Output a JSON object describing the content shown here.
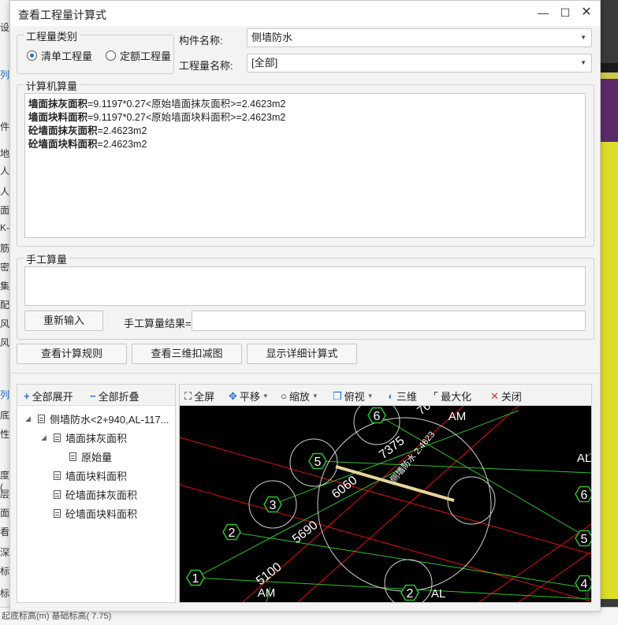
{
  "background": {
    "left_fragments": [
      "设",
      "列",
      "件",
      "地",
      "人",
      "人",
      "面-",
      "K-",
      "筋",
      "密",
      "集",
      "配",
      "风",
      "风",
      "列",
      "底",
      "性",
      "度(",
      "层",
      "面",
      "看",
      "深",
      "标",
      "标"
    ],
    "bottom_text": "起底标高(m)  基础标高( 7.75)"
  },
  "dialog": {
    "title": "查看工程量计算式",
    "category_group": {
      "legend": "工程量类别",
      "options": [
        {
          "label": "清单工程量",
          "selected": true
        },
        {
          "label": "定额工程量",
          "selected": false
        }
      ]
    },
    "component": {
      "label": "构件名称:",
      "value": "侧墙防水"
    },
    "quantity_name": {
      "label": "工程量名称:",
      "value": "[全部]"
    },
    "computer_group": {
      "legend": "计算机算量",
      "lines": [
        {
          "name": "墙面抹灰面积",
          "expr": "=9.1197*0.27<原始墙面抹灰面积>=2.4623m2"
        },
        {
          "name": "墙面块料面积",
          "expr": "=9.1197*0.27<原始墙面块料面积>=2.4623m2"
        },
        {
          "name": "砼墙面抹灰面积",
          "expr": "=2.4623m2"
        },
        {
          "name": "砼墙面块料面积",
          "expr": "=2.4623m2"
        }
      ]
    },
    "manual_group": {
      "legend": "手工算量",
      "reinput_button": "重新输入",
      "result_label": "手工算量结果=",
      "result_value": ""
    },
    "buttons": {
      "view_rules": "查看计算规则",
      "view_3d": "查看三维扣减图",
      "show_detail": "显示详细计算式"
    },
    "tree": {
      "expand_all": "全部展开",
      "collapse_all": "全部折叠",
      "root": "侧墙防水<2+940,AL-117...",
      "children": [
        {
          "label": "墙面抹灰面积",
          "children": [
            {
              "label": "原始量"
            }
          ]
        },
        {
          "label": "墙面块料面积"
        },
        {
          "label": "砼墙面抹灰面积"
        },
        {
          "label": "砼墙面块料面积"
        }
      ]
    },
    "viewer": {
      "toolbar": {
        "fullscreen": "全屏",
        "pan": "平移",
        "zoom": "缩放",
        "view": "俯视",
        "three_d": "三维",
        "maximize": "最大化",
        "close": "关闭"
      },
      "labels": {
        "dim1": "7375",
        "dim2": "6060",
        "dim3": "5690",
        "dim4": "5100",
        "beam": "侧墙防水 2.4623",
        "cut": "76"
      },
      "axes": [
        "6",
        "5",
        "3",
        "2",
        "1",
        "AM",
        "AL",
        "6",
        "5",
        "4",
        "AM",
        "2",
        "AL"
      ]
    }
  }
}
